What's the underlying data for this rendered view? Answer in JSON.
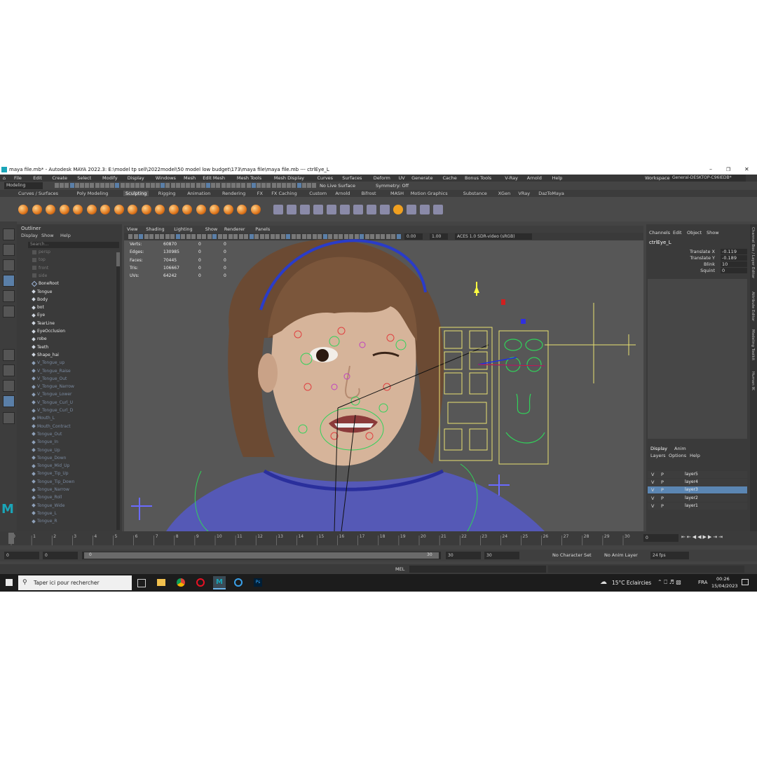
{
  "window": {
    "title": "maya file.mb* - Autodesk MAYA 2022.3: E:\\model tp sell\\2022model\\50 model low budget\\173\\maya file\\maya file.mb  ---  ctrlEye_L"
  },
  "menu": [
    "File",
    "Edit",
    "Create",
    "Select",
    "Modify",
    "Display",
    "Windows",
    "Mesh",
    "Edit Mesh",
    "Mesh Tools",
    "Mesh Display",
    "Curves",
    "Surfaces",
    "Deform",
    "UV",
    "Generate",
    "Cache",
    "Bonus Tools",
    "V-Ray",
    "Arnold",
    "Help"
  ],
  "workspace": {
    "label": "Workspace:",
    "value": "General-DESKTOP-C96IEDB*"
  },
  "status": {
    "mode": "Modeling",
    "live_surface": "No Live Surface",
    "symmetry": "Symmetry: Off"
  },
  "shelf_tabs": [
    "Curves / Surfaces",
    "Poly Modeling",
    "Sculpting",
    "Rigging",
    "Animation",
    "Rendering",
    "FX",
    "FX Caching",
    "Custom",
    "Arnold",
    "Bifrost",
    "MASH",
    "Motion Graphics",
    "Substance",
    "XGen",
    "VRay",
    "DazToMaya"
  ],
  "shelf_active": "Sculpting",
  "outliner": {
    "title": "Outliner",
    "menu": [
      "Display",
      "Show",
      "Help"
    ],
    "search_placeholder": "Search...",
    "cameras": [
      "persp",
      "top",
      "front",
      "side"
    ],
    "items": [
      "BoneRoot",
      "Tongue",
      "Body",
      "bot",
      "Eye",
      "TearLine",
      "EyeOcclusion",
      "robe",
      "Teeth",
      "Shape_hai"
    ],
    "blend_items": [
      "V_Tongue_up",
      "V_Tongue_Raise",
      "V_Tongue_Out",
      "V_Tongue_Narrow",
      "V_Tongue_Lower",
      "V_Tongue_Curl_U",
      "V_Tongue_Curl_D",
      "Mouth_L",
      "Mouth_Contract",
      "Tongue_Out",
      "Tongue_In",
      "Tongue_Up",
      "Tongue_Down",
      "Tongue_Mid_Up",
      "Tongue_Tip_Up",
      "Tongue_Tip_Down",
      "Tongue_Narrow",
      "Tongue_Roll",
      "Tongue_Wide",
      "Tongue_L",
      "Tongue_R"
    ]
  },
  "viewport": {
    "menu": [
      "View",
      "Shading",
      "Lighting",
      "Show",
      "Renderer",
      "Panels"
    ],
    "exposure": "0.00",
    "gamma": "1.00",
    "color_space": "ACES 1.0 SDR-video (sRGB)",
    "hud": [
      {
        "label": "Verts:",
        "a": "60870",
        "b": "0",
        "c": "0"
      },
      {
        "label": "Edges:",
        "a": "130985",
        "b": "0",
        "c": "0"
      },
      {
        "label": "Faces:",
        "a": "70445",
        "b": "0",
        "c": "0"
      },
      {
        "label": "Tris:",
        "a": "106667",
        "b": "0",
        "c": "0"
      },
      {
        "label": "UVs:",
        "a": "64242",
        "b": "0",
        "c": "0"
      }
    ]
  },
  "channel_box": {
    "menu": [
      "Channels",
      "Edit",
      "Object",
      "Show"
    ],
    "object": "ctrlEye_L",
    "attrs": [
      {
        "name": "Translate X",
        "value": "-0.119"
      },
      {
        "name": "Translate Y",
        "value": "-0.189"
      },
      {
        "name": "Blink",
        "value": "10"
      },
      {
        "name": "Squint",
        "value": "0"
      }
    ]
  },
  "layer_editor": {
    "tabs": [
      "Display",
      "Anim"
    ],
    "menu": [
      "Layers",
      "Options",
      "Help"
    ],
    "layers": [
      {
        "v": "V",
        "p": "P",
        "name": "layer5"
      },
      {
        "v": "V",
        "p": "P",
        "name": "layer4"
      },
      {
        "v": "V",
        "p": "P",
        "name": "layer3"
      },
      {
        "v": "V",
        "p": "P",
        "name": "layer2"
      },
      {
        "v": "V",
        "p": "P",
        "name": "layer1"
      }
    ],
    "selected": "layer3"
  },
  "side_tabs": [
    "Channel Box / Layer Editor",
    "Attribute Editor",
    "Modeling Toolkit",
    "Human IK"
  ],
  "timeline": {
    "ticks": [
      "0",
      "1",
      "2",
      "3",
      "4",
      "5",
      "6",
      "7",
      "8",
      "9",
      "10",
      "11",
      "12",
      "13",
      "14",
      "15",
      "16",
      "17",
      "18",
      "19",
      "20",
      "21",
      "22",
      "23",
      "24",
      "25",
      "26",
      "27",
      "28",
      "29",
      "30"
    ],
    "current_frame": "0"
  },
  "range": {
    "start": "0",
    "anim_start": "0",
    "slider_start": "0",
    "slider_end": "30",
    "end": "30",
    "anim_end": "30",
    "character_set": "No Character Set",
    "anim_layer": "No Anim Layer",
    "fps": "24 fps"
  },
  "command": {
    "lang": "MEL"
  },
  "taskbar": {
    "search": "Taper ici pour rechercher",
    "weather": "15°C  Eclaircies",
    "lang": "FRA",
    "time": "00:26",
    "date": "15/04/2023"
  },
  "colors": {
    "accent": "#5a7fa8",
    "selection": "#5b86b3",
    "maya_blue": "#1aa5b8"
  }
}
